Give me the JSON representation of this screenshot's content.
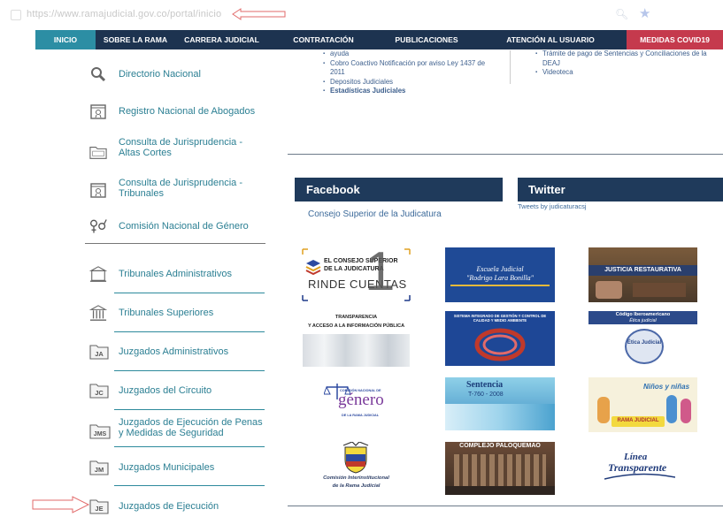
{
  "browser": {
    "url": "https://www.ramajudicial.gov.co/portal/inicio"
  },
  "nav": {
    "items": [
      "INICIO",
      "SOBRE LA RAMA",
      "CARRERA JUDICIAL",
      "CONTRATACIÓN",
      "PUBLICACIONES",
      "ATENCIÓN AL USUARIO",
      "MEDIDAS COVID19"
    ]
  },
  "sidebar": {
    "items": [
      {
        "label": "Directorio Nacional",
        "icon": "search-icon"
      },
      {
        "label": "Registro Nacional de Abogados",
        "icon": "certificate-icon"
      },
      {
        "label": "Consulta de Jurisprudencia - Altas Cortes",
        "icon": "folder-icon"
      },
      {
        "label": "Consulta de Jurisprudencia - Tribunales",
        "icon": "certificate-icon"
      },
      {
        "label": "Comisión Nacional de Género",
        "icon": "gender-icon"
      },
      {
        "label": "Tribunales Administrativos",
        "icon": "building-icon"
      },
      {
        "label": "Tribunales Superiores",
        "icon": "courthouse-icon"
      },
      {
        "label": "Juzgados Administrativos",
        "icon": "folder-ja-icon",
        "code": "JA"
      },
      {
        "label": "Juzgados del Circuito",
        "icon": "folder-jc-icon",
        "code": "JC"
      },
      {
        "label": "Juzgados de Ejecución de Penas y Medidas de Seguridad",
        "icon": "folder-jms-icon",
        "code": "JMS"
      },
      {
        "label": "Juzgados Municipales",
        "icon": "folder-jm-icon",
        "code": "JM"
      },
      {
        "label": "Juzgados de Ejecución",
        "icon": "folder-je-icon",
        "code": "JE"
      }
    ]
  },
  "links_left": {
    "items": [
      "ayuda",
      "Cobro Coactivo Notificación por aviso Ley 1437 de 2011",
      "Depositos Judiciales",
      "Estadísticas Judiciales"
    ]
  },
  "links_right": {
    "items": [
      "Trámite de pago de Sentencias y Conciliaciones de la DEAJ",
      "Videoteca"
    ]
  },
  "facebook": {
    "title": "Facebook",
    "link": "Consejo Superior de la Judicatura"
  },
  "twitter": {
    "title": "Twitter",
    "link": "Tweets by judicaturacsj"
  },
  "banners": {
    "rinde": {
      "line1": "EL CONSEJO SUPERIOR",
      "line2": "DE LA JUDICATURA",
      "line3": "RINDE CUENTAS",
      "number": "1"
    },
    "escuela": {
      "line1": "Escuela Judicial",
      "line2": "\"Rodrigo Lara Bonilla\""
    },
    "justicia": {
      "text": "JUSTICIA RESTAURATIVA"
    },
    "transparencia": {
      "line1": "TRANSPARENCIA",
      "line2": "Y ACCESO A LA INFORMACIÓN PÚBLICA"
    },
    "sistema": {
      "text": "SISTEMA INTEGRADO DE GESTIÓN Y CONTROL DE CALIDAD Y MEDIO AMBIENTE"
    },
    "etica": {
      "line1": "Código Iberoamericano",
      "line2": "Ética judicial",
      "badge": "Ética Judicial"
    },
    "genero": {
      "small": "COMISIÓN NACIONAL DE",
      "big": "género",
      "sub": "DE LA RAMA JUDICIAL"
    },
    "sentencia": {
      "line1": "Sentencia",
      "line2": "T-760 - 2008"
    },
    "ninos": {
      "line1": "Niños y niñas",
      "line2": "RAMA JUDICIAL"
    },
    "comision": {
      "line1": "Comisión Interinstitucional",
      "line2": "de la Rama Judicial"
    },
    "complejo": {
      "text": "COMPLEJO PALOQUEMAO"
    },
    "linea": {
      "line1": "Línea",
      "line2": "Transparente"
    }
  }
}
